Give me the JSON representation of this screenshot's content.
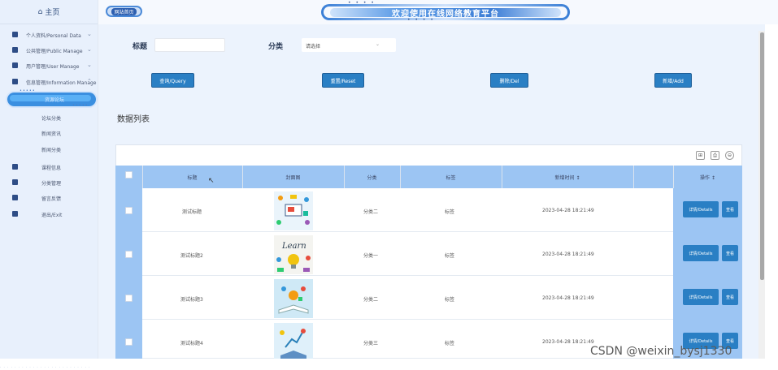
{
  "sidebar": {
    "home": "主页",
    "items": [
      {
        "label": "个人资料/Personal Data"
      },
      {
        "label": "公共管理/Public Manage"
      },
      {
        "label": "用户管理/User Manage"
      },
      {
        "label": "信息管理/Information Manage"
      }
    ],
    "active": "资源论坛",
    "subs": [
      "论坛分类",
      "新闻资讯",
      "新闻分类"
    ],
    "others": [
      "课程信息",
      "分类管理",
      "留言反馈",
      "退出/Exit"
    ]
  },
  "topbar": {
    "tab": "网站首页",
    "banner": "欢迎使用在线网络教育平台"
  },
  "search": {
    "title_label": "标题",
    "category_label": "分类",
    "category_placeholder": "请选择",
    "query": "查询/Query",
    "reset": "重置/Reset",
    "delete": "删除/Del",
    "add": "新增/Add"
  },
  "list_title": "数据列表",
  "table": {
    "headers": [
      "标题",
      "封面图",
      "分类",
      "标签",
      "新增时间 ↕",
      "操作 ↕"
    ],
    "rows": [
      {
        "title": "测试标题",
        "category": "分类二",
        "tag": "标签",
        "time": "2023-04-28 18:21:49",
        "detail": "详情/Details",
        "view": "查看"
      },
      {
        "title": "测试标题2",
        "category": "分类一",
        "tag": "标签",
        "time": "2023-04-28 18:21:49",
        "detail": "详情/Details",
        "view": "查看"
      },
      {
        "title": "测试标题3",
        "category": "分类二",
        "tag": "标签",
        "time": "2023-04-28 18:21:49",
        "detail": "详情/Details",
        "view": "查看"
      },
      {
        "title": "测试标题4",
        "category": "分类三",
        "tag": "标签",
        "time": "2023-04-28 18:21:49",
        "detail": "详情/Details",
        "view": "查看"
      }
    ]
  },
  "watermark": "CSDN @weixin_bysj1330"
}
